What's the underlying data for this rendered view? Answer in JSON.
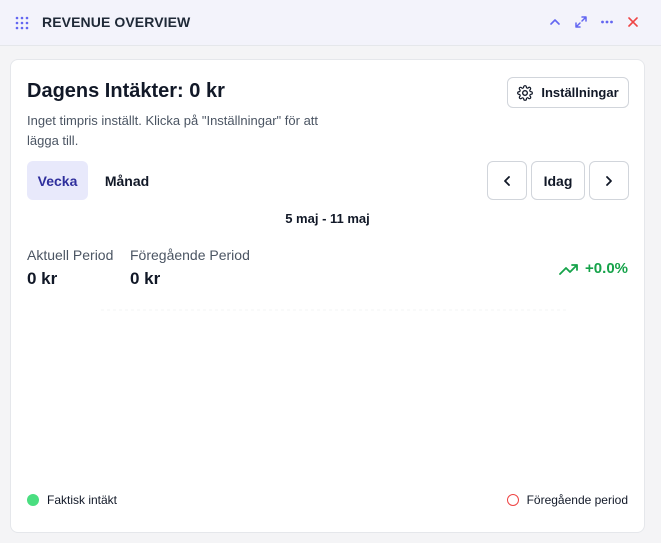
{
  "window": {
    "title": "REVENUE OVERVIEW",
    "icons": [
      "drag-handle-icon",
      "chevron-up-icon",
      "expand-icon",
      "more-icon",
      "close-icon"
    ]
  },
  "card": {
    "heading": "Dagens Intäkter: 0 kr",
    "subtext": "Inget timpris inställt. Klicka på \"Inställningar\" för att lägga till.",
    "settings_label": "Inställningar",
    "tabs": [
      {
        "label": "Vecka",
        "active": true
      },
      {
        "label": "Månad",
        "active": false
      }
    ],
    "nav": {
      "prev_icon": "chevron-left-icon",
      "today_label": "Idag",
      "next_icon": "chevron-right-icon"
    },
    "date_range": "5 maj - 11 maj",
    "metrics": {
      "current_label": "Aktuell Period",
      "current_value": "0 kr",
      "previous_label": "Föregående Period",
      "previous_value": "0 kr",
      "change": "+0.0%"
    },
    "legend": {
      "actual": "Faktisk intäkt",
      "previous": "Föregående period"
    }
  },
  "colors": {
    "accent": "#2f2f9d",
    "accent_bg": "#e8e9fb",
    "positive": "#16a34a",
    "actual_series": "#4ade80",
    "previous_series": "#ef4444",
    "close": "#ef4444"
  }
}
